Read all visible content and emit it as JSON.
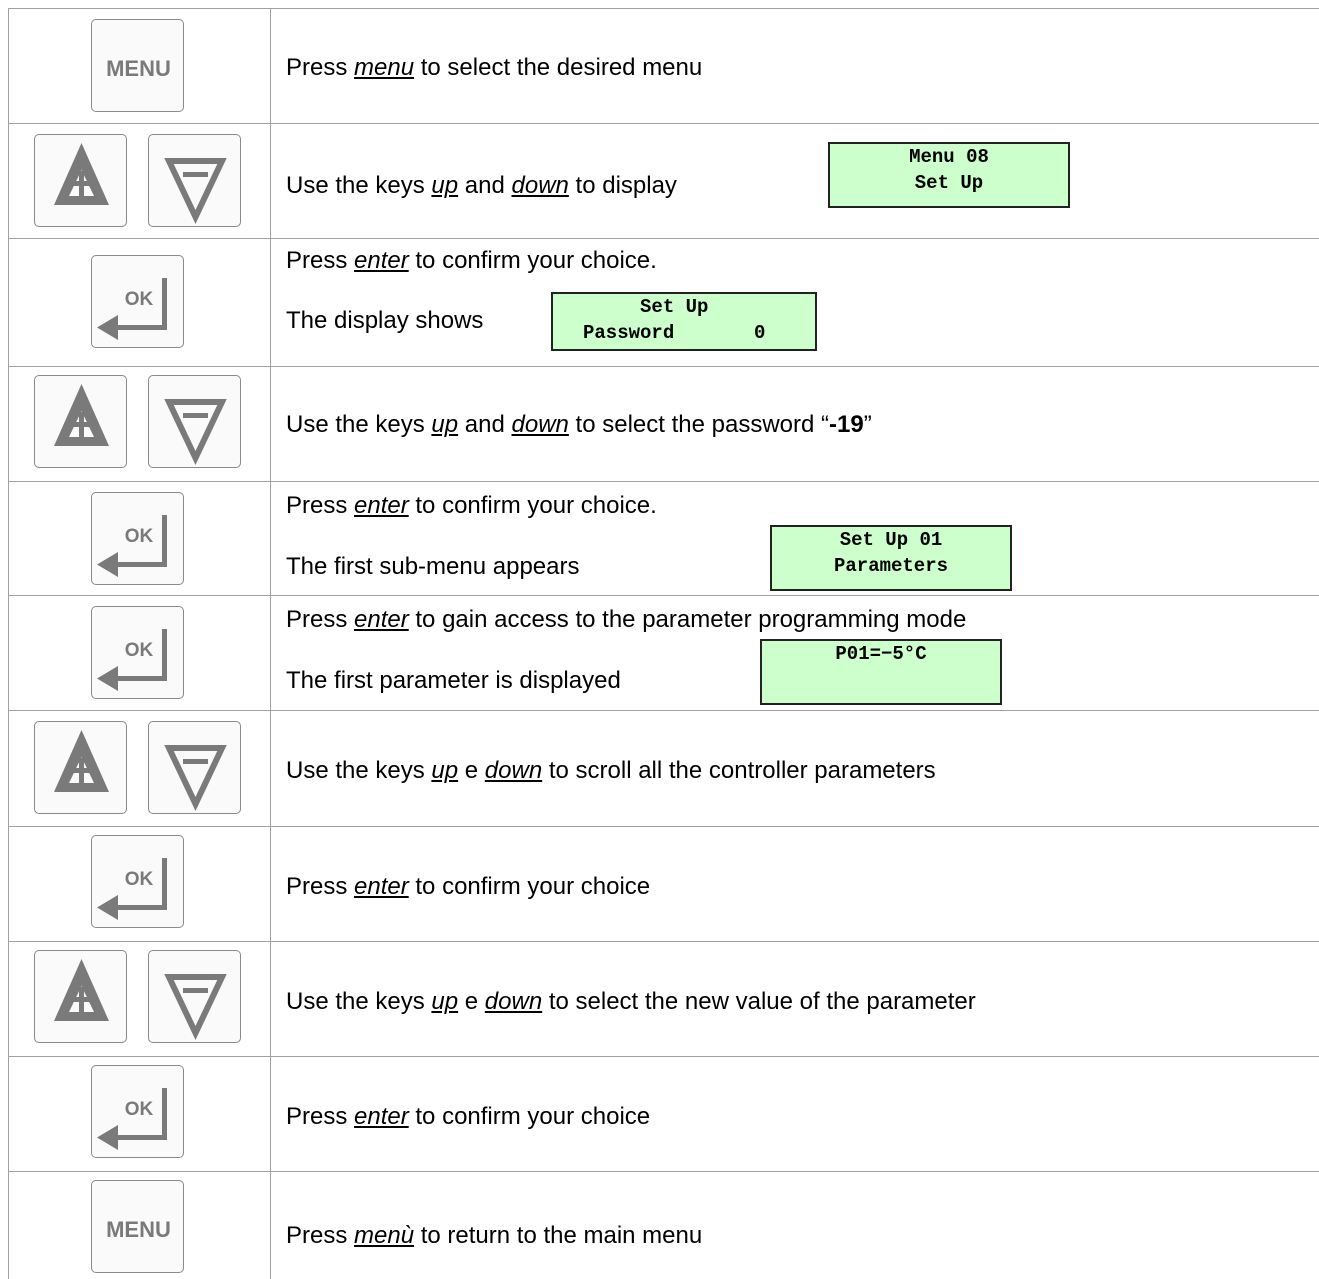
{
  "rows": [
    {
      "key": "menu",
      "key_label": "MENU",
      "lines": [
        {
          "pre": "Press ",
          "em": "menu",
          "post": " to select the desired menu"
        }
      ]
    },
    {
      "key": "updown",
      "lines": [
        {
          "pre": "Use the keys ",
          "em": "up",
          "mid": " and ",
          "em2": "down",
          "post": " to display"
        }
      ],
      "lcd": [
        "Menu 08",
        "Set Up"
      ]
    },
    {
      "key": "ok",
      "key_label": "OK",
      "lines": [
        {
          "pre": "Press ",
          "em": "enter",
          "post": " to confirm your choice."
        },
        {
          "pre": "The display shows"
        }
      ],
      "lcd": [
        "     Set Up",
        "Password       0"
      ]
    },
    {
      "key": "updown",
      "lines": [
        {
          "pre": "Use the keys ",
          "em": "up",
          "mid": " and ",
          "em2": "down",
          "post": " to select the password  “",
          "bold": "-19",
          "post2": "”"
        }
      ]
    },
    {
      "key": "ok",
      "key_label": "OK",
      "lines": [
        {
          "pre": "Press ",
          "em": "enter",
          "post": " to confirm your choice."
        },
        {
          "pre": "The first sub-menu appears"
        }
      ],
      "lcd": [
        "Set Up 01",
        "Parameters"
      ]
    },
    {
      "key": "ok",
      "key_label": "OK",
      "lines": [
        {
          "pre": "Press ",
          "em": "enter",
          "post": " to gain access to the parameter programming mode"
        },
        {
          "pre": "The first parameter is displayed"
        }
      ],
      "lcd": [
        "P01=−5°C",
        ""
      ]
    },
    {
      "key": "updown",
      "lines": [
        {
          "pre": "Use the keys ",
          "em": "up",
          "mid": " e ",
          "em2": "down",
          "post": " to scroll all the controller parameters"
        }
      ]
    },
    {
      "key": "ok",
      "key_label": "OK",
      "lines": [
        {
          "pre": "Press ",
          "em": "enter",
          "post": " to confirm your choice"
        }
      ]
    },
    {
      "key": "updown",
      "lines": [
        {
          "pre": "Use the keys ",
          "em": "up",
          "mid": " e ",
          "em2": "down",
          "post": " to select the new value of the parameter"
        }
      ]
    },
    {
      "key": "ok",
      "key_label": "OK",
      "lines": [
        {
          "pre": "Press ",
          "em": "enter",
          "post": " to confirm your choice"
        }
      ]
    },
    {
      "key": "menu",
      "key_label": "MENU",
      "lines": [
        {
          "pre": "Press ",
          "em": "menù",
          "post": "  to return to the main menu"
        }
      ]
    }
  ],
  "colors": {
    "lcd_bg": "#ccffcc",
    "key_gray": "#7a7a7a"
  }
}
